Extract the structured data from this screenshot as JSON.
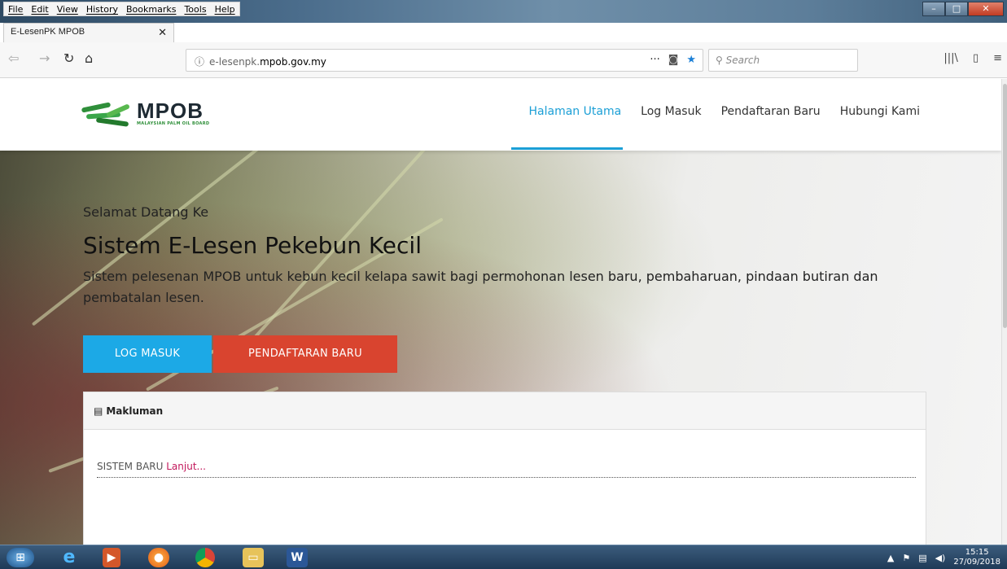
{
  "browser": {
    "menu": [
      "File",
      "Edit",
      "View",
      "History",
      "Bookmarks",
      "Tools",
      "Help"
    ],
    "tab_title": "E-LesenPK MPOB",
    "url_prefix": "e-lesenpk.",
    "url_domain": "mpob.gov.my",
    "search_placeholder": "Search"
  },
  "site": {
    "logo_name": "MPOB",
    "logo_sub": "MALAYSIAN PALM OIL BOARD",
    "nav": [
      "Halaman Utama",
      "Log Masuk",
      "Pendaftaran Baru",
      "Hubungi Kami"
    ],
    "active_nav": "Halaman Utama"
  },
  "hero": {
    "welcome": "Selamat Datang Ke",
    "title": "Sistem E-Lesen Pekebun Kecil",
    "description": "Sistem pelesenan MPOB untuk kebun kecil kelapa sawit bagi permohonan lesen baru, pembaharuan, pindaan butiran dan pembatalan lesen.",
    "btn_login": "LOG MASUK",
    "btn_register": "PENDAFTARAN BARU"
  },
  "notice": {
    "heading": "Makluman",
    "item_text": "SISTEM BARU",
    "item_link": "Lanjut..."
  },
  "taskbar": {
    "time": "15:15",
    "date": "27/09/2018"
  },
  "colors": {
    "accent": "#1b9fd6",
    "login_button": "#1ca9e6",
    "register_button": "#d9442f",
    "link": "#c2185b"
  }
}
